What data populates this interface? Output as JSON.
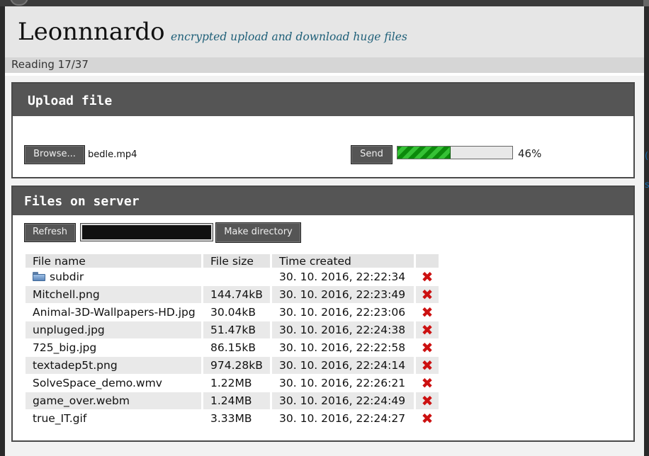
{
  "header": {
    "title": "Leonnnardo",
    "tagline": "encrypted upload and download huge files"
  },
  "status": {
    "text": "Reading 17/37"
  },
  "upload": {
    "heading": "Upload file",
    "browse_label": "Browse...",
    "selected_file": "bedle.mp4",
    "send_label": "Send",
    "progress_fraction": 0.46,
    "progress_text": "46%"
  },
  "files": {
    "heading": "Files on server",
    "refresh_label": "Refresh",
    "dir_input_value": "",
    "make_dir_label": "Make directory",
    "columns": [
      "File name",
      "File size",
      "Time created",
      ""
    ],
    "rows": [
      {
        "name": "subdir",
        "size": "",
        "time": "30. 10. 2016, 22:22:34",
        "is_dir": true
      },
      {
        "name": "Mitchell.png",
        "size": "144.74kB",
        "time": "30. 10. 2016, 22:23:49"
      },
      {
        "name": "Animal-3D-Wallpapers-HD.jpg",
        "size": "30.04kB",
        "time": "30. 10. 2016, 22:23:06"
      },
      {
        "name": "unpluged.jpg",
        "size": "51.47kB",
        "time": "30. 10. 2016, 22:24:38"
      },
      {
        "name": "725_big.jpg",
        "size": "86.15kB",
        "time": "30. 10. 2016, 22:22:58"
      },
      {
        "name": "textadep5t.png",
        "size": "974.28kB",
        "time": "30. 10. 2016, 22:24:14"
      },
      {
        "name": "SolveSpace_demo.wmv",
        "size": "1.22MB",
        "time": "30. 10. 2016, 22:26:21"
      },
      {
        "name": "game_over.webm",
        "size": "1.24MB",
        "time": "30. 10. 2016, 22:24:49"
      },
      {
        "name": "true_IT.gif",
        "size": "3.33MB",
        "time": "30. 10. 2016, 22:24:27"
      }
    ],
    "delete_glyph": "✖"
  },
  "colors": {
    "panel_header": "#555555",
    "tagline": "#1e5f78",
    "progress": "#0b8a0b",
    "delete": "#cc1111"
  }
}
